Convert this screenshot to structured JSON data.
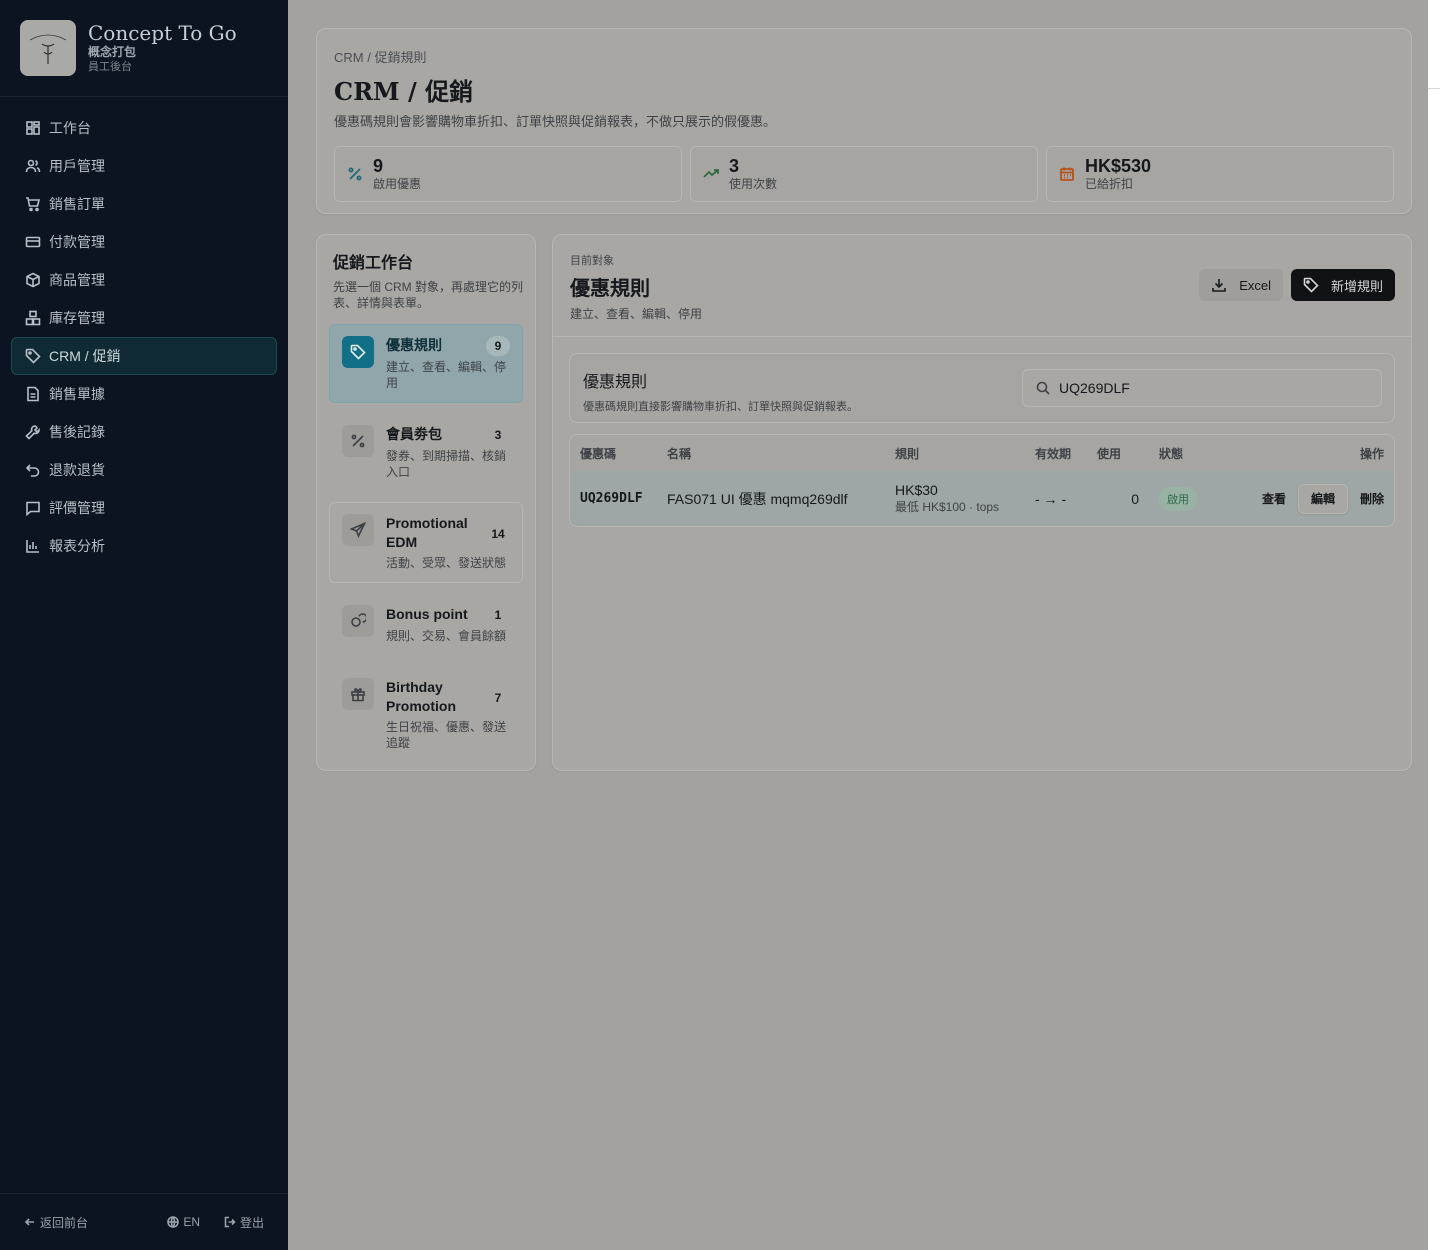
{
  "brand": {
    "name": "Concept To Go",
    "sub": "概念打包",
    "sub2": "員工後台",
    "logo_text": "CONCEPT TO GO"
  },
  "nav": [
    {
      "label": "工作台",
      "icon": "dashboard-icon"
    },
    {
      "label": "用戶管理",
      "icon": "users-icon"
    },
    {
      "label": "銷售訂單",
      "icon": "cart-icon"
    },
    {
      "label": "付款管理",
      "icon": "credit-card-icon"
    },
    {
      "label": "商品管理",
      "icon": "package-icon"
    },
    {
      "label": "庫存管理",
      "icon": "boxes-icon"
    },
    {
      "label": "CRM / 促銷",
      "icon": "tag-icon",
      "active": true
    },
    {
      "label": "銷售單據",
      "icon": "file-icon"
    },
    {
      "label": "售後記錄",
      "icon": "wrench-icon"
    },
    {
      "label": "退款退貨",
      "icon": "undo-icon"
    },
    {
      "label": "評價管理",
      "icon": "message-icon"
    },
    {
      "label": "報表分析",
      "icon": "bar-chart-icon"
    }
  ],
  "footer": {
    "back": "返回前台",
    "lang": "EN",
    "logout": "登出"
  },
  "header": {
    "breadcrumb": "CRM / 促銷規則",
    "title": "CRM / 促銷",
    "desc": "優惠碼規則會影響購物車折扣、訂單快照與促銷報表，不做只展示的假優惠。",
    "stats": [
      {
        "value": "9",
        "label": "啟用優惠",
        "icon": "percent-icon",
        "color": "#1d6b7c"
      },
      {
        "value": "3",
        "label": "使用次數",
        "icon": "trending-up-icon",
        "color": "#2f6b44"
      },
      {
        "value": "HK$530",
        "label": "已給折扣",
        "icon": "calendar-icon",
        "color": "#b4541e"
      }
    ]
  },
  "workspace": {
    "title": "促銷工作台",
    "desc": "先選一個 CRM 對象，再處理它的列表、詳情與表單。",
    "objects": [
      {
        "name": "優惠規則",
        "count": "9",
        "desc": "建立、查看、編輯、停用",
        "icon": "tag-icon"
      },
      {
        "name": "會員劵包",
        "count": "3",
        "desc": "發券、到期掃描、核銷入口",
        "icon": "percent-icon"
      },
      {
        "name": "Promotional EDM",
        "count": "14",
        "desc": "活動、受眾、發送狀態",
        "icon": "send-icon"
      },
      {
        "name": "Bonus point",
        "count": "1",
        "desc": "規則、交易、會員餘額",
        "icon": "coins-icon"
      },
      {
        "name": "Birthday Promotion",
        "count": "7",
        "desc": "生日祝福、優惠、發送追蹤",
        "icon": "gift-icon"
      }
    ]
  },
  "main": {
    "kicker": "目前對象",
    "title": "優惠規則",
    "desc": "建立、查看、編輯、停用",
    "excel_label": "Excel",
    "new_label": "新增規則",
    "rules_box": {
      "title": "優惠規則",
      "desc": "優惠碼規則直接影響購物車折扣、訂單快照與促銷報表。"
    },
    "search": {
      "value": "UQ269DLF",
      "placeholder": ""
    },
    "table": {
      "columns": [
        "優惠碼",
        "名稱",
        "規則",
        "有效期",
        "使用",
        "狀態",
        "操作"
      ],
      "rows": [
        {
          "code": "UQ269DLF",
          "name": "FAS071 UI 優惠 mqmq269dlf",
          "rule_main": "HK$30",
          "rule_sub": "最低 HK$100 · tops",
          "validity": "- → -",
          "used": "0",
          "status": "啟用",
          "actions": {
            "view": "查看",
            "edit": "編輯",
            "delete": "刪除"
          }
        }
      ]
    }
  }
}
